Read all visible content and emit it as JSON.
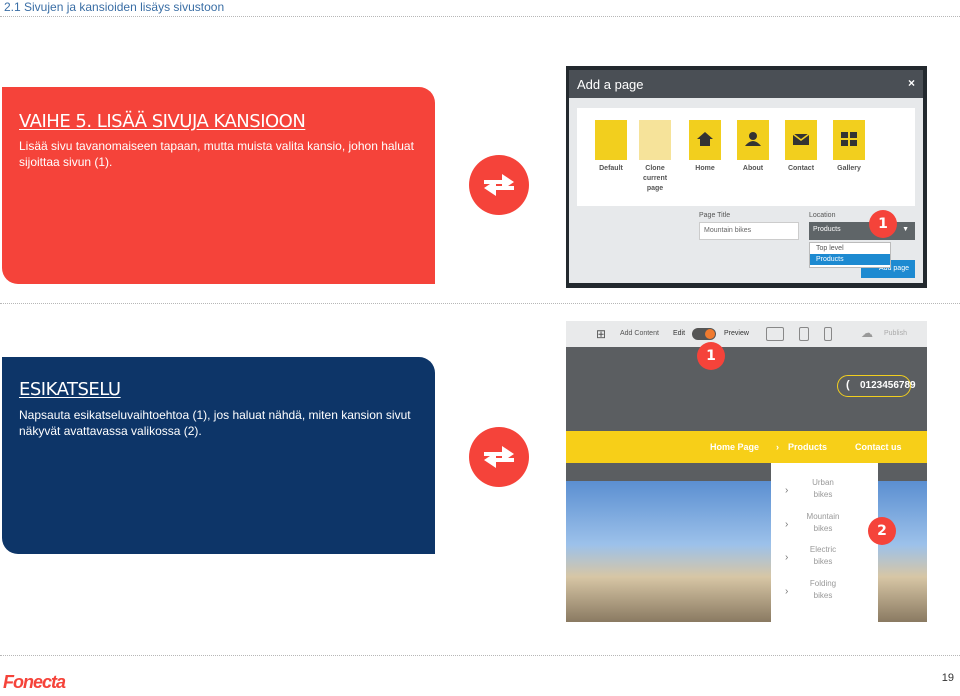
{
  "header": {
    "title": "2.1 Sivujen ja kansioiden lisäys sivustoon"
  },
  "step5": {
    "heading": "VAIHE 5. LISÄÄ SIVUJA KANSIOON",
    "text": "Lisää sivu tavanomaiseen tapaan, mutta muista valita kansio, johon haluat sijoittaa sivun (1)."
  },
  "preview": {
    "heading": "ESIKATSELU",
    "text": "Napsauta esikatseluvaihtoehtoa (1), jos haluat nähdä, miten kansion sivut näkyvät avattavassa valikossa (2)."
  },
  "add_page_dialog": {
    "title": "Add a page",
    "close": "×",
    "templates": [
      {
        "label": "Default",
        "icon": "document-icon"
      },
      {
        "label": "Clone current page",
        "icon": "clone-icon"
      },
      {
        "label": "Home",
        "icon": "home-icon"
      },
      {
        "label": "About",
        "icon": "person-icon"
      },
      {
        "label": "Contact",
        "icon": "mail-icon"
      },
      {
        "label": "Gallery",
        "icon": "gallery-icon"
      }
    ],
    "page_title_label": "Page Title",
    "page_title_value": "Mountain bikes",
    "location_label": "Location",
    "location_value": "Products",
    "dropdown_options": [
      "Top level",
      "Products"
    ],
    "add_button": "Add page",
    "badge": "1"
  },
  "editor_preview": {
    "toolbar": {
      "add_content": "Add Content",
      "edit": "Edit",
      "preview": "Preview",
      "publish": "Publish"
    },
    "badge1": "1",
    "phone": "0123456789",
    "nav": [
      "Home Page",
      "Products",
      "Contact us"
    ],
    "submenu": [
      "Urban bikes",
      "Mountain bikes",
      "Electric bikes",
      "Folding bikes"
    ],
    "badge2": "2"
  },
  "footer": {
    "logo": "Fonecta",
    "page_number": "19"
  },
  "colors": {
    "red": "#f5433a",
    "navy": "#0d3568",
    "yellow": "#f2cf1e",
    "blue": "#1d8ad1"
  }
}
